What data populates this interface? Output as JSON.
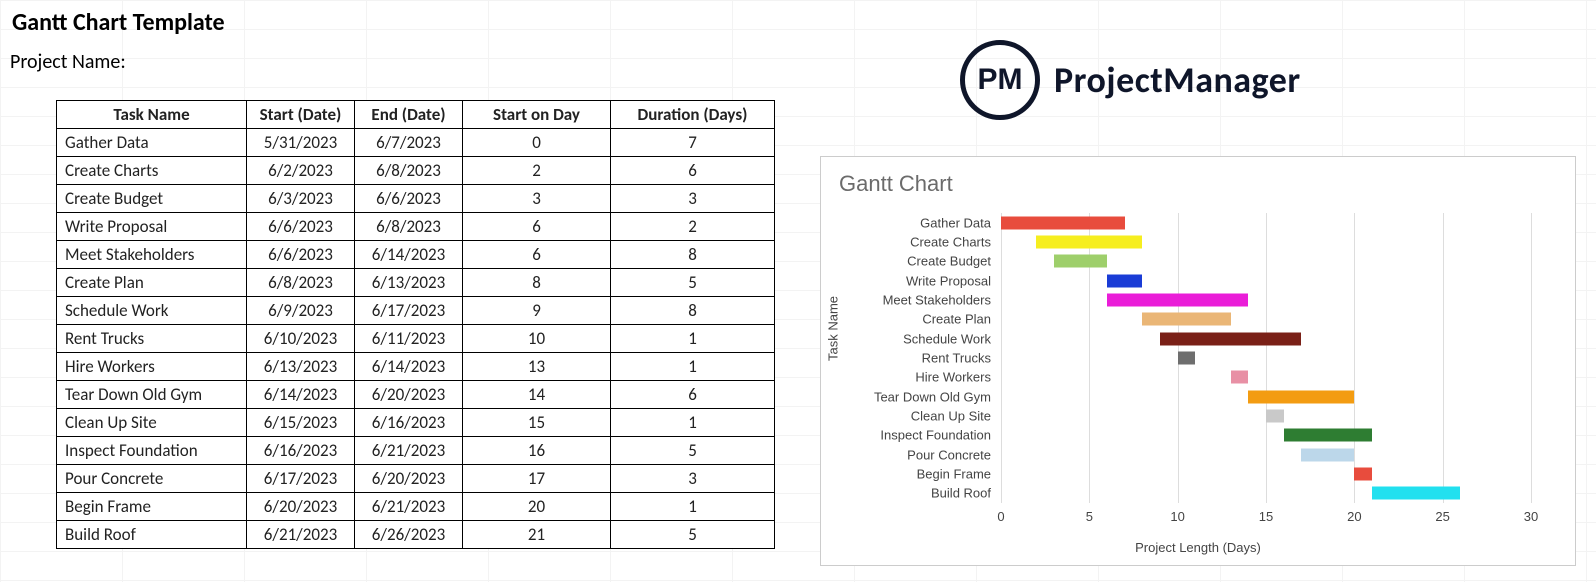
{
  "title": "Gantt Chart Template",
  "project_label": "Project Name:",
  "logo": {
    "badge": "PM",
    "text": "ProjectManager"
  },
  "table": {
    "headers": [
      "Task Name",
      "Start (Date)",
      "End (Date)",
      "Start on Day",
      "Duration (Days)"
    ],
    "rows": [
      {
        "name": "Gather Data",
        "start": "5/31/2023",
        "end": "6/7/2023",
        "start_day": 0,
        "duration": 7
      },
      {
        "name": "Create Charts",
        "start": "6/2/2023",
        "end": "6/8/2023",
        "start_day": 2,
        "duration": 6
      },
      {
        "name": "Create Budget",
        "start": "6/3/2023",
        "end": "6/6/2023",
        "start_day": 3,
        "duration": 3
      },
      {
        "name": "Write Proposal",
        "start": "6/6/2023",
        "end": "6/8/2023",
        "start_day": 6,
        "duration": 2
      },
      {
        "name": "Meet Stakeholders",
        "start": "6/6/2023",
        "end": "6/14/2023",
        "start_day": 6,
        "duration": 8
      },
      {
        "name": "Create Plan",
        "start": "6/8/2023",
        "end": "6/13/2023",
        "start_day": 8,
        "duration": 5
      },
      {
        "name": "Schedule Work",
        "start": "6/9/2023",
        "end": "6/17/2023",
        "start_day": 9,
        "duration": 8
      },
      {
        "name": "Rent Trucks",
        "start": "6/10/2023",
        "end": "6/11/2023",
        "start_day": 10,
        "duration": 1
      },
      {
        "name": "Hire Workers",
        "start": "6/13/2023",
        "end": "6/14/2023",
        "start_day": 13,
        "duration": 1
      },
      {
        "name": "Tear Down Old Gym",
        "start": "6/14/2023",
        "end": "6/20/2023",
        "start_day": 14,
        "duration": 6
      },
      {
        "name": "Clean Up Site",
        "start": "6/15/2023",
        "end": "6/16/2023",
        "start_day": 15,
        "duration": 1
      },
      {
        "name": "Inspect Foundation",
        "start": "6/16/2023",
        "end": "6/21/2023",
        "start_day": 16,
        "duration": 5
      },
      {
        "name": "Pour Concrete",
        "start": "6/17/2023",
        "end": "6/20/2023",
        "start_day": 17,
        "duration": 3
      },
      {
        "name": "Begin Frame",
        "start": "6/20/2023",
        "end": "6/21/2023",
        "start_day": 20,
        "duration": 1
      },
      {
        "name": "Build Roof",
        "start": "6/21/2023",
        "end": "6/26/2023",
        "start_day": 21,
        "duration": 5
      }
    ]
  },
  "chart_data": {
    "type": "bar",
    "title": "Gantt Chart",
    "xlabel": "Project Length (Days)",
    "ylabel": "Task Name",
    "xlim": [
      0,
      30
    ],
    "xticks": [
      0,
      5,
      10,
      15,
      20,
      25,
      30
    ],
    "categories": [
      "Gather Data",
      "Create Charts",
      "Create Budget",
      "Write Proposal",
      "Meet Stakeholders",
      "Create Plan",
      "Schedule Work",
      "Rent Trucks",
      "Hire Workers",
      "Tear Down Old Gym",
      "Clean Up Site",
      "Inspect Foundation",
      "Pour Concrete",
      "Begin Frame",
      "Build Roof"
    ],
    "series": [
      {
        "name": "Gather Data",
        "start": 0,
        "duration": 7,
        "color": "#e84c3d"
      },
      {
        "name": "Create Charts",
        "start": 2,
        "duration": 6,
        "color": "#f6ee1f"
      },
      {
        "name": "Create Budget",
        "start": 3,
        "duration": 3,
        "color": "#9ecf6b"
      },
      {
        "name": "Write Proposal",
        "start": 6,
        "duration": 2,
        "color": "#1a3cd6"
      },
      {
        "name": "Meet Stakeholders",
        "start": 6,
        "duration": 8,
        "color": "#ea1dd8"
      },
      {
        "name": "Create Plan",
        "start": 8,
        "duration": 5,
        "color": "#eab676"
      },
      {
        "name": "Schedule Work",
        "start": 9,
        "duration": 8,
        "color": "#7a2017"
      },
      {
        "name": "Rent Trucks",
        "start": 10,
        "duration": 1,
        "color": "#6e6e6e"
      },
      {
        "name": "Hire Workers",
        "start": 13,
        "duration": 1,
        "color": "#e890a5"
      },
      {
        "name": "Tear Down Old Gym",
        "start": 14,
        "duration": 6,
        "color": "#f39c12"
      },
      {
        "name": "Clean Up Site",
        "start": 15,
        "duration": 1,
        "color": "#c9c9c9"
      },
      {
        "name": "Inspect Foundation",
        "start": 16,
        "duration": 5,
        "color": "#2e7d32"
      },
      {
        "name": "Pour Concrete",
        "start": 17,
        "duration": 3,
        "color": "#bcd7ea"
      },
      {
        "name": "Begin Frame",
        "start": 20,
        "duration": 1,
        "color": "#e84c3d"
      },
      {
        "name": "Build Roof",
        "start": 21,
        "duration": 5,
        "color": "#22e0ef"
      }
    ]
  }
}
